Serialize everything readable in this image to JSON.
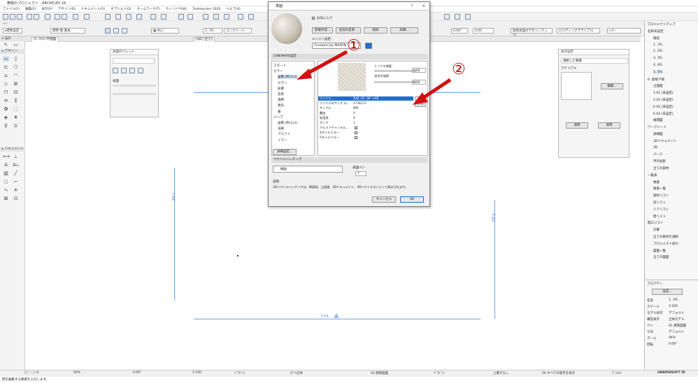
{
  "app": {
    "title": "無題のプロジェクト - ARCHICAD 24",
    "menu": [
      "ファイル(F)",
      "編集(E)",
      "表示(V)",
      "デザイン(D)",
      "ドキュメント(O)",
      "オプション(O)",
      "チームワーク(T)",
      "ウィンドウ(W)",
      "Teamworker 2020",
      "ヘルプ(H)"
    ]
  },
  "infobox": {
    "pen_label": "標準-壁-基本",
    "layer_value": "[L: 建物] 3",
    "elevation": "0.00°",
    "scale_value": "1:100",
    "floor_label": "1. 1FL",
    "concrete": "コンクリート",
    "floorname": "壁面",
    "rendering_label": "屋根表面のデザインマップ...",
    "building_material": "ビルディングマテリアル"
  },
  "tabs": [
    {
      "label": "[1. 1FL] 平面図"
    },
    {
      "label": "[3D / 全て]"
    }
  ],
  "toolbox": {
    "sections": [
      "▸ 設計",
      "▸ デザイン",
      "▸ ドキュメント"
    ],
    "selection_label": "矢印"
  },
  "grid_labels": {
    "left": "F-04",
    "right": "F-02",
    "bottom": "F-01"
  },
  "floating_palette": {
    "title": "表面のパレット",
    "label1": "表面"
  },
  "right_palette": {
    "title": "表示設定",
    "item1": "選択した要素",
    "btn1": "編集...",
    "btn2": "適用",
    "label_material": "マテリアル"
  },
  "navigator": {
    "title": "プロジェクトマップ",
    "items": [
      "名称未設定",
      "階段",
      "1. 1FL",
      "2. 2FL",
      "3. 3FL",
      "4. 4FL",
      "5. 5FL",
      "6. 屋根下端",
      "立面図",
      "1-01 (未設定)",
      "1-02 (未設定)",
      "E-02 (未設定)",
      "E-04 (未設定)",
      "展開図",
      "ワークシート",
      "詳細図",
      "3Dドキュメント",
      "3D",
      "パース",
      "平行投影",
      "全ての部材",
      "一覧表",
      "要素",
      "要素一覧",
      "部材リスト",
      "窓リスト",
      "ドアリスト",
      "壁リスト",
      "開口リスト",
      "計算",
      "全ての部材を選択",
      "プロジェクト索引",
      "図面一覧",
      "全ての図面"
    ],
    "props_title": "プロパティ",
    "props": [
      {
        "k": "名前",
        "v": "1. 1FL"
      },
      {
        "k": "スケール",
        "v": "1:100"
      },
      {
        "k": "モデル表示",
        "v": "デフォルト"
      },
      {
        "k": "構造表示",
        "v": "全体モデル"
      },
      {
        "k": "ペン",
        "v": "01 建築図面"
      },
      {
        "k": "寸法",
        "v": "デフォルト"
      },
      {
        "k": "ズーム",
        "v": "94%"
      },
      {
        "k": "回転",
        "v": "0.00°"
      }
    ],
    "settings_btn": "設定..."
  },
  "statusbar": {
    "zoom": "94%",
    "angle": "0.00°",
    "scale": "1:100",
    "layer_combo": "ﾌﾟﾗｸﾞｲﾝ",
    "model_view": "ﾓﾃﾞﾙ全体",
    "pen_set": "01 建築図面",
    "dim": "ﾌﾟﾗｸﾞｲﾝ",
    "renov": "上書きなし",
    "filter": "04 すべての既存を表示",
    "sun": "ﾃﾞﾌｫﾙﾄ",
    "brand": "GRAPHISOFT ID",
    "message": "壁を編集する要素を入力します。"
  },
  "dialog": {
    "title": "表面",
    "favorites": "お気に入り",
    "btn_new": "新規作成...",
    "btn_rename": "名前の変更...",
    "btn_delete": "削除",
    "btn_more": "詳細...",
    "engine_label": "エンジン設定:",
    "engine_value": "Cineware by MAXON",
    "section_header": "CINEWARE設定",
    "tree": [
      "スタート",
      "カラー",
      "画像 (例:1x1)",
      "カラー",
      "拡散",
      "反射",
      "透明",
      "発光",
      "霧",
      "バンプ",
      "画像 (例:1x1)",
      "法線",
      "アルファ",
      "イラー"
    ],
    "expand_btn": "詳細設定...",
    "prop_mix": "ミックス強度:",
    "prop_blend": "混合の強度:",
    "mix_value": "0.00",
    "blend_value": "0.00",
    "props": [
      {
        "k": "ファイル",
        "v": "木材 -01 .06 -×68"
      },
      {
        "k": "ファイルのサイズ (x...",
        "v": "2736273"
      },
      {
        "k": "サンプル",
        "v": "MIP"
      },
      {
        "k": "露出",
        "v": "0"
      },
      {
        "k": "彩度高",
        "v": "0"
      },
      {
        "k": "ガンマ",
        "v": "1"
      },
      {
        "k": "アルファチャンネル...",
        "v": ""
      },
      {
        "k": "Xタイルミラー",
        "v": ""
      },
      {
        "k": "Yタイルミラー",
        "v": ""
      }
    ],
    "browse_btn": "...",
    "file_btn": "ﾌｧｲﾙ",
    "vectorhatch_header": "ベクトルハッチング",
    "hatch_value": "線画",
    "pen_label": "表面ペン",
    "pen_value": "1",
    "desc_label": "説明",
    "desc_text": "3Dベクトルハッチングは、断面図、立面図、3Dドキュメント、3Dベクトルエンジンで表示されます。",
    "cancel": "キャンセル",
    "ok": "OK"
  },
  "annotations": {
    "one": "①",
    "two": "②"
  },
  "colors": {
    "grid_blue": "#6ea4e0",
    "arrow_red": "#d31010",
    "selected_row": "#1f6fd0"
  }
}
